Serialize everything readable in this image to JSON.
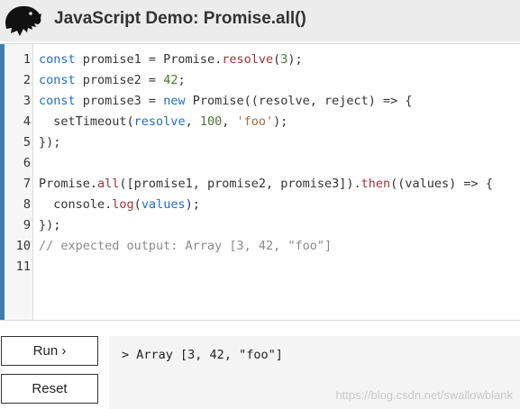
{
  "header": {
    "title": "JavaScript Demo: Promise.all()",
    "logo_icon": "dinosaur-logo-icon"
  },
  "editor": {
    "line_numbers": [
      "1",
      "2",
      "3",
      "4",
      "5",
      "6",
      "7",
      "8",
      "9",
      "10",
      "11"
    ],
    "lines": [
      [
        {
          "t": "const",
          "c": "kw"
        },
        {
          "t": " promise1 = Promise.",
          "c": ""
        },
        {
          "t": "resolve",
          "c": "fn"
        },
        {
          "t": "(",
          "c": ""
        },
        {
          "t": "3",
          "c": "num"
        },
        {
          "t": ");",
          "c": ""
        }
      ],
      [
        {
          "t": "const",
          "c": "kw"
        },
        {
          "t": " promise2 = ",
          "c": ""
        },
        {
          "t": "42",
          "c": "num"
        },
        {
          "t": ";",
          "c": ""
        }
      ],
      [
        {
          "t": "const",
          "c": "kw"
        },
        {
          "t": " promise3 = ",
          "c": ""
        },
        {
          "t": "new",
          "c": "kw"
        },
        {
          "t": " Promise((resolve, reject) => {",
          "c": ""
        }
      ],
      [
        {
          "t": "  setTimeout(",
          "c": ""
        },
        {
          "t": "resolve",
          "c": "arg"
        },
        {
          "t": ", ",
          "c": ""
        },
        {
          "t": "100",
          "c": "num"
        },
        {
          "t": ", ",
          "c": ""
        },
        {
          "t": "'foo'",
          "c": "str"
        },
        {
          "t": ");",
          "c": ""
        }
      ],
      [
        {
          "t": "});",
          "c": ""
        }
      ],
      [],
      [
        {
          "t": "Promise.",
          "c": ""
        },
        {
          "t": "all",
          "c": "fn"
        },
        {
          "t": "([promise1, promise2, promise3]).",
          "c": ""
        },
        {
          "t": "then",
          "c": "fn"
        },
        {
          "t": "((values) => {",
          "c": ""
        }
      ],
      [
        {
          "t": "  console.",
          "c": ""
        },
        {
          "t": "log",
          "c": "fn"
        },
        {
          "t": "(",
          "c": ""
        },
        {
          "t": "values",
          "c": "arg"
        },
        {
          "t": ");",
          "c": ""
        }
      ],
      [
        {
          "t": "});",
          "c": ""
        }
      ],
      [
        {
          "t": "// expected output: Array [3, 42, \"foo\"]",
          "c": "cmt"
        }
      ],
      []
    ]
  },
  "controls": {
    "run_label": "Run ›",
    "reset_label": "Reset"
  },
  "output": {
    "prompt": ">",
    "text": "Array [3, 42, \"foo\"]"
  },
  "watermark": "https://blog.csdn.net/swallowblank",
  "colors": {
    "accent": "#3d7eaa",
    "keyword": "#1f6fbf",
    "function": "#a3313c",
    "number": "#4a7a2c",
    "string": "#a8693d",
    "comment": "#8a8a8a"
  }
}
